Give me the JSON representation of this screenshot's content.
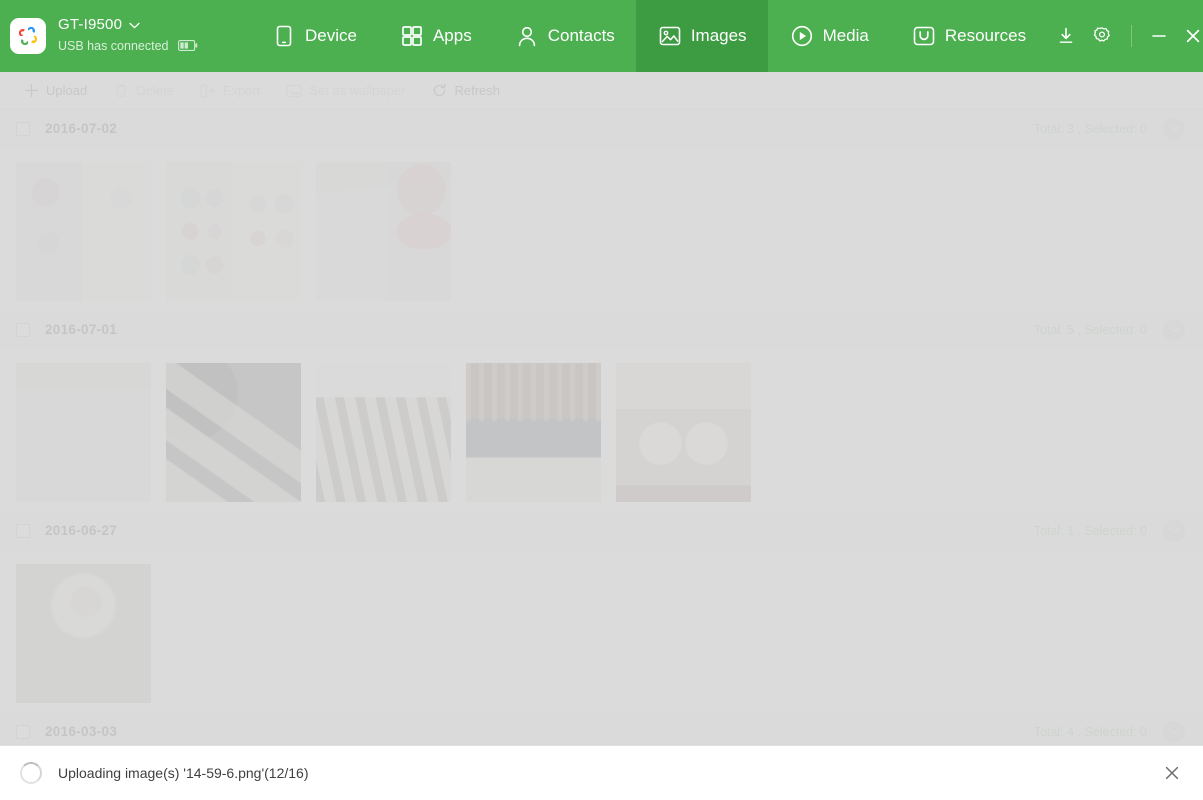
{
  "header": {
    "logo_icon": "app-logo-icon",
    "device_name": "GT-I9500",
    "device_chevron_icon": "chevron-down-icon",
    "device_status": "USB has connected",
    "battery_icon": "battery-icon",
    "nav": [
      {
        "label": "Device",
        "icon": "phone-icon",
        "active": false
      },
      {
        "label": "Apps",
        "icon": "grid-icon",
        "active": false
      },
      {
        "label": "Contacts",
        "icon": "person-icon",
        "active": false
      },
      {
        "label": "Images",
        "icon": "image-icon",
        "active": true
      },
      {
        "label": "Media",
        "icon": "play-icon",
        "active": false
      },
      {
        "label": "Resources",
        "icon": "resources-icon",
        "active": false
      }
    ],
    "tools": [
      {
        "name": "download-icon",
        "title": "Download"
      },
      {
        "name": "gear-icon",
        "title": "Settings"
      }
    ],
    "window_buttons": [
      {
        "name": "minimize-icon",
        "title": "Minimize"
      },
      {
        "name": "close-icon",
        "title": "Close"
      }
    ],
    "colors": {
      "header_green": "#4caf50",
      "active_tab_green": "#3d9c41",
      "status_text": "#d8f0d9"
    }
  },
  "toolbar": {
    "items": [
      {
        "label": "Upload",
        "icon": "plus-icon",
        "disabled": false
      },
      {
        "label": "Delete",
        "icon": "trash-icon",
        "disabled": true
      },
      {
        "label": "Export",
        "icon": "export-icon",
        "disabled": true
      },
      {
        "label": "Set as wallpaper",
        "icon": "wallpaper-icon",
        "disabled": true
      },
      {
        "label": "Refresh",
        "icon": "refresh-icon",
        "disabled": false
      }
    ]
  },
  "groups": [
    {
      "date": "2016-07-02",
      "count_text": "Total: 3 , Selected: 0",
      "total": 3,
      "selected": 0,
      "checked": false,
      "collapse_icon": "chevron-down-icon",
      "thumbs": [
        {
          "name": "thumbnail-screenshot-1"
        },
        {
          "name": "thumbnail-screenshot-2"
        },
        {
          "name": "thumbnail-screenshot-3"
        }
      ]
    },
    {
      "date": "2016-07-01",
      "count_text": "Total: 5 , Selected: 0",
      "total": 5,
      "selected": 0,
      "checked": false,
      "collapse_icon": "chevron-down-icon",
      "thumbs": [
        {
          "name": "thumbnail-photo-1"
        },
        {
          "name": "thumbnail-photo-2"
        },
        {
          "name": "thumbnail-photo-3"
        },
        {
          "name": "thumbnail-photo-4"
        },
        {
          "name": "thumbnail-photo-5"
        }
      ]
    },
    {
      "date": "2016-06-27",
      "count_text": "Total: 1 , Selected: 0",
      "total": 1,
      "selected": 0,
      "checked": false,
      "collapse_icon": "chevron-down-icon",
      "thumbs": [
        {
          "name": "thumbnail-food-1"
        }
      ]
    },
    {
      "date": "2016-03-03",
      "count_text": "Total: 4 , Selected: 0",
      "total": 4,
      "selected": 0,
      "checked": false,
      "collapse_icon": "chevron-down-icon",
      "thumbs": []
    }
  ],
  "statusbar": {
    "spinner_icon": "loading-spinner-icon",
    "message": "Uploading image(s) '14-59-6.png'(12/16)",
    "file_name": "14-59-6.png",
    "progress_current": 12,
    "progress_total": 16,
    "close_icon": "close-icon"
  }
}
